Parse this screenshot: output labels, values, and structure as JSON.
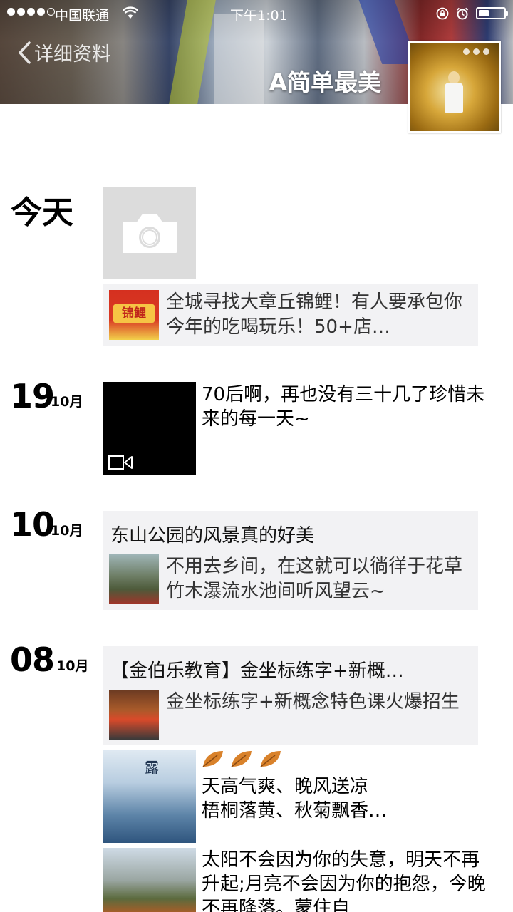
{
  "status_bar": {
    "carrier": "中国联通",
    "time": "下午1:01"
  },
  "header": {
    "back_label": "详细资料",
    "username": "A简单最美"
  },
  "timeline": {
    "today": {
      "label": "今天",
      "share_text": "全城寻找大章丘锦鲤！有人要承包你今年的吃喝玩乐！50+店…",
      "share_thumb_text": "锦鲤"
    },
    "day19": {
      "day": "19",
      "month": "10月",
      "text": "70后啊，再也没有三十几了珍惜未来的每一天~"
    },
    "day10": {
      "day": "10",
      "month": "10月",
      "card_title": "东山公园的风景真的好美",
      "share_text": "不用去乡间，在这就可以徜徉于花草竹木瀑流水池间听风望云~"
    },
    "day08": {
      "day": "08",
      "month": "10月",
      "card_title": "【金伯乐教育】金坐标练字+新概…",
      "share_text": "金坐标练字+新概念特色课火爆招生",
      "post1_text": "天高气爽、晚风送凉\n梧桐落黄、秋菊飘香…",
      "post1_thumb_text": "露",
      "post2_text": "太阳不会因为你的失意，明天不再升起;月亮不会因为你的抱怨，今晚不再降落。蒙住自"
    }
  },
  "colors": {
    "card_bg": "#f2f2f4",
    "camera_bg": "#dcdcdc",
    "leaf": "#d9822b"
  },
  "icons": {
    "back": "chevron-left-icon",
    "camera": "camera-icon",
    "video": "video-icon",
    "more": "more-dots-icon",
    "leaf": "autumn-leaf-icon"
  }
}
